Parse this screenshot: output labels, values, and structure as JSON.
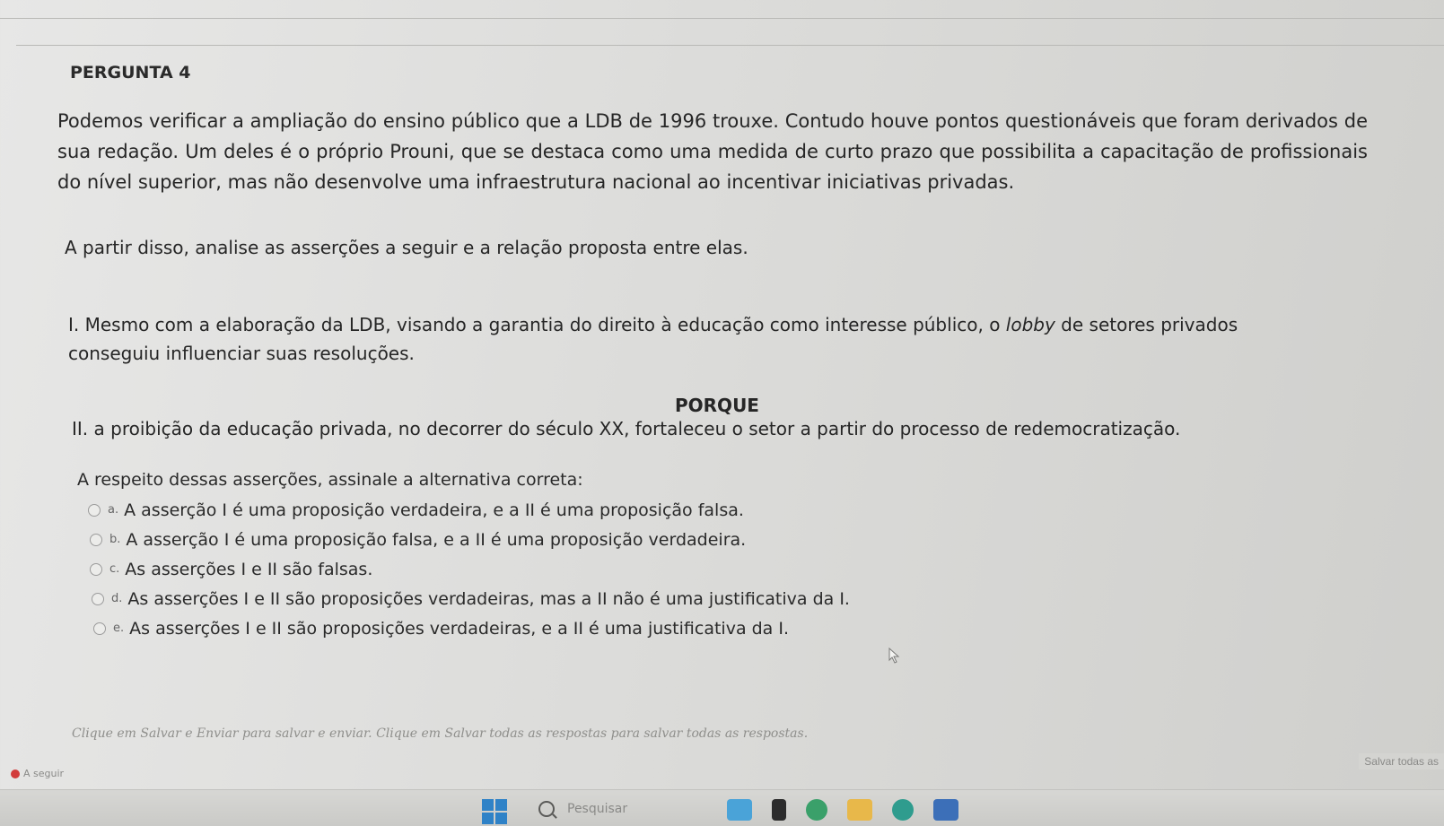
{
  "question": {
    "label": "PERGUNTA 4",
    "body": "Podemos verificar a ampliação do ensino público que a LDB de 1996 trouxe. Contudo houve pontos questionáveis que foram derivados de sua redação. Um deles é o próprio Prouni, que se destaca como uma medida de curto prazo que possibilita a capacitação de profissionais do nível superior, mas não desenvolve uma infraestrutura nacional ao incentivar iniciativas privadas.",
    "instruction": "A partir disso, analise as asserções a seguir e a relação proposta entre elas.",
    "assertion_1_before": "I. Mesmo com a elaboração da LDB, visando a garantia do direito à educação como interesse público, o ",
    "assertion_1_italic": "lobby",
    "assertion_1_after": " de setores privados conseguiu influenciar suas resoluções.",
    "porque": "PORQUE",
    "assertion_2": "II. a proibição da educação privada, no decorrer do século XX, fortaleceu o setor a partir do processo de redemocratização.",
    "prompt": "A respeito dessas asserções, assinale a alternativa correta:"
  },
  "options": [
    {
      "letter": "a.",
      "text": "A asserção I é uma proposição verdadeira, e a II é uma proposição falsa."
    },
    {
      "letter": "b.",
      "text": "A asserção I é uma proposição falsa, e a II é uma proposição verdadeira."
    },
    {
      "letter": "c.",
      "text": "As asserções I e II são falsas."
    },
    {
      "letter": "d.",
      "text": "As asserções I e II são proposições verdadeiras, mas a II não é uma justificativa da I."
    },
    {
      "letter": "e.",
      "text": "As asserções I e II são proposições verdadeiras, e a II é uma justificativa da I."
    }
  ],
  "footer": {
    "hint": "Clique em Salvar e Enviar para salvar e enviar. Clique em Salvar todas as respostas para salvar todas as respostas.",
    "save_all_label": "Salvar todas as",
    "next_label": "A seguir"
  },
  "taskbar": {
    "search_placeholder": "Pesquisar",
    "accent_color": "#2f82c7"
  }
}
